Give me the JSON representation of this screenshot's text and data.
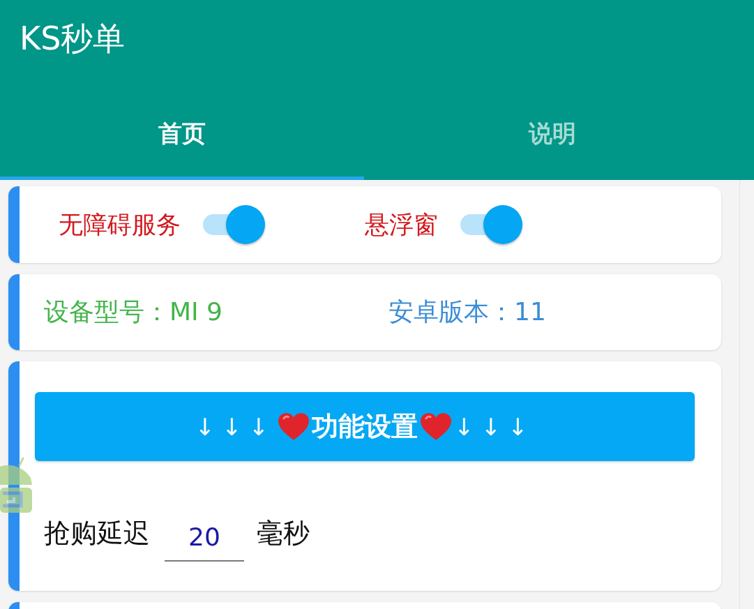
{
  "app_bar": {
    "title": "KS秒单"
  },
  "tabs": [
    {
      "label": "首页",
      "selected": true
    },
    {
      "label": "说明",
      "selected": false
    }
  ],
  "switch_card": {
    "switches": [
      {
        "label": "无障碍服务",
        "on": true
      },
      {
        "label": "悬浮窗",
        "on": true
      }
    ]
  },
  "device_card": {
    "model": "设备型号：MI 9",
    "android_version": "安卓版本：11"
  },
  "settings_card": {
    "button": {
      "parts": [
        {
          "kind": "arrows",
          "text": "↓↓↓"
        },
        {
          "kind": "heart"
        },
        {
          "kind": "text",
          "text": "功能设置"
        },
        {
          "kind": "heart"
        },
        {
          "kind": "arrows",
          "text": "↓↓↓"
        }
      ]
    },
    "delay": {
      "label": "抢购延迟",
      "value": "20",
      "unit": "毫秒"
    }
  }
}
